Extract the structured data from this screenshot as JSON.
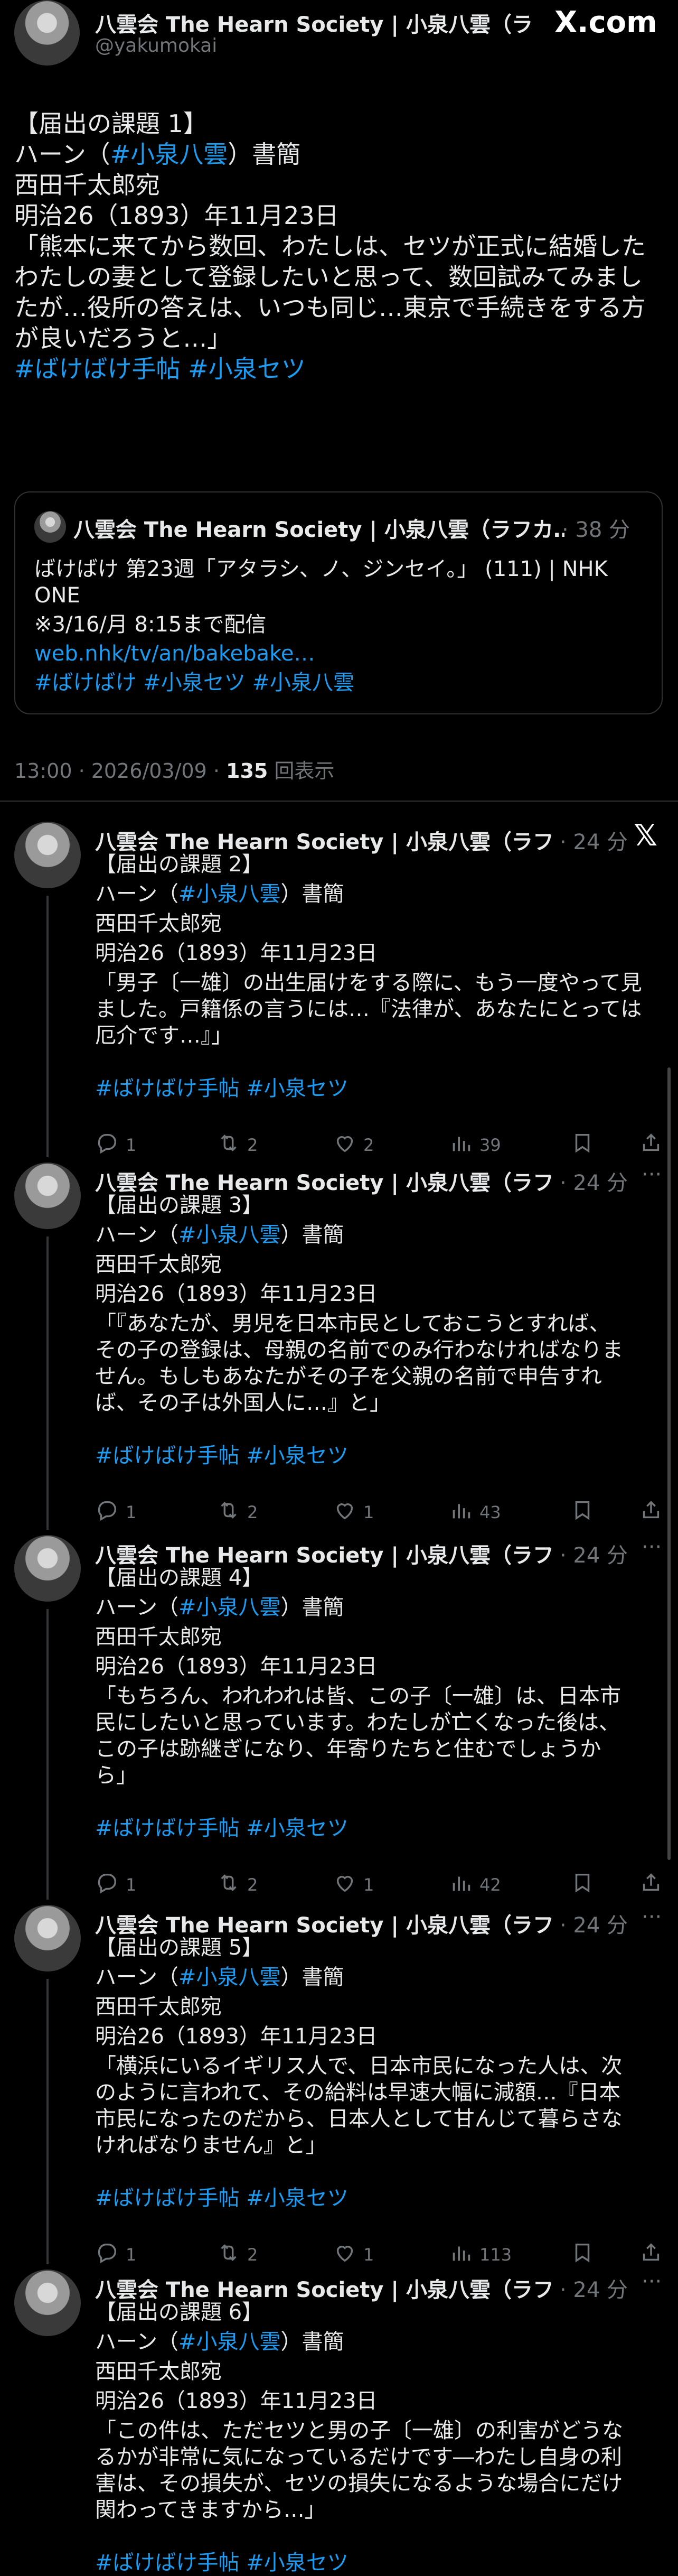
{
  "header": {
    "name": "八雲会 The Hearn Society | 小泉八雲（ラフ…",
    "handle": "@yakumokai",
    "logo": "X.com"
  },
  "main": {
    "lines": [
      "【届出の課題 1】",
      "ハーン（",
      "西田千太郎宛",
      "明治26（1893）年11月23日",
      "「熊本に来てから数回、わたしは、セツが正式に結婚した",
      "わたしの妻として登録したいと思って、数回試みてみまし",
      "たが…役所の答えは、いつも同じ…東京で手続きをする方",
      "が良いだろうと…」"
    ],
    "hashtag_yakumo": "#小泉八雲",
    "suffix_shokan": "）書簡",
    "hashtags": "#ばけばけ手帖 #小泉セツ",
    "quote": {
      "name": "八雲会 The Hearn Society | 小泉八雲（ラフカ…",
      "time": "· 38 分",
      "line1": "ばけばけ 第23週「アタラシ、ノ、ジンセイ。」 (111) | NHK",
      "line2": "ONE",
      "line3": "※3/16/月 8:15まで配信",
      "link": "web.nhk/tv/an/bakebake…",
      "hashtags": "#ばけばけ #小泉セツ #小泉八雲"
    },
    "meta_time": "13:00 · 2026/03/09 · ",
    "meta_views": "135",
    "meta_views_label": " 回表示"
  },
  "replies": [
    {
      "name": "八雲会 The Hearn Society | 小泉八雲（ラフ…",
      "time": "· 24 分",
      "title": "【届出の課題 2】",
      "lines": [
        "「男子〔一雄〕の出生届けをする際に、もう一度やって見",
        "ました。戸籍係の言うには…『法律が、あなたにとっては",
        "厄介です…』」"
      ],
      "reply": "1",
      "repost": "2",
      "like": "2",
      "views": "39"
    },
    {
      "name": "八雲会 The Hearn Society | 小泉八雲（ラフ…",
      "time": "· 24 分",
      "title": "【届出の課題 3】",
      "lines": [
        "「『あなたが、男児を日本市民としておこうとすれば、",
        "その子の登録は、母親の名前でのみ行わなければなりま",
        "せん。もしもあなたがその子を父親の名前で申告すれ",
        "ば、その子は外国人に…』と」"
      ],
      "reply": "1",
      "repost": "2",
      "like": "1",
      "views": "43"
    },
    {
      "name": "八雲会 The Hearn Society | 小泉八雲（ラフ…",
      "time": "· 24 分",
      "title": "【届出の課題 4】",
      "lines": [
        "「もちろん、われわれは皆、この子〔一雄〕は、日本市",
        "民にしたいと思っています。わたしが亡くなった後は、",
        "この子は跡継ぎになり、年寄りたちと住むでしょうか",
        "ら」"
      ],
      "reply": "1",
      "repost": "2",
      "like": "1",
      "views": "42"
    },
    {
      "name": "八雲会 The Hearn Society | 小泉八雲（ラフ…",
      "time": "· 24 分",
      "title": "【届出の課題 5】",
      "lines": [
        "「横浜にいるイギリス人で、日本市民になった人は、次",
        "のように言われて、その給料は早速大幅に減額…『日本",
        "市民になったのだから、日本人として甘んじて暮らさな",
        "ければなりません』と」"
      ],
      "reply": "1",
      "repost": "2",
      "like": "1",
      "views": "113"
    },
    {
      "name": "八雲会 The Hearn Society | 小泉八雲（ラフ…",
      "time": "· 24 分",
      "title": "【届出の課題 6】",
      "lines": [
        "「この件は、ただセツと男の子〔一雄〕の利害がどうな",
        "るかが非常に気になっているだけです―わたし自身の利",
        "害は、その損失が、セツの損失になるような場合にだけ",
        "関わってきますから…」"
      ]
    }
  ],
  "common": {
    "prefix_hearn": "ハーン（",
    "recipient": "西田千太郎宛",
    "date": "明治26（1893）年11月23日",
    "hashtags": "#ばけばけ手帖 #小泉セツ",
    "menu": "···",
    "x_logo": "𝕏"
  },
  "colors": {
    "background": "#000000",
    "text": "#e7e9ea",
    "muted": "#71767b",
    "link": "#1d9bf0",
    "border": "#2f3336"
  }
}
